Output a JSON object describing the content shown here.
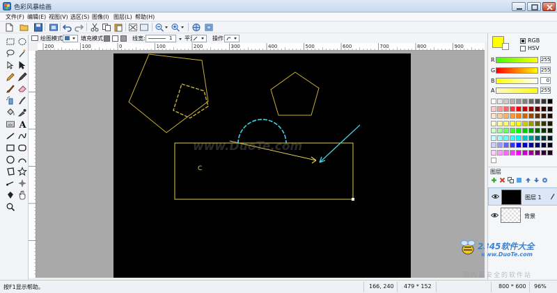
{
  "window": {
    "title": "色彩风暴绘画"
  },
  "menu": [
    "文件(F)",
    "编辑(E)",
    "视图(V)",
    "选区(S)",
    "图像(I)",
    "图层(L)",
    "帮助(H)"
  ],
  "options": {
    "draw_mode_label": "绘图模式:",
    "fill_mode_label": "填充模式:",
    "line_width_label": "线宽:",
    "line_width_value": "1",
    "smooth_label": "平滑:",
    "operation_label": "操作:"
  },
  "ruler_h_ticks": [
    "200",
    "100",
    "0",
    "100",
    "200",
    "300",
    "400",
    "500",
    "600",
    "700",
    "800",
    "900"
  ],
  "ruler_v_ticks": [
    "100",
    "200",
    "300",
    "400",
    "500"
  ],
  "color": {
    "primary": "#ffff00",
    "mode_rgb": "RGB",
    "mode_hsv": "HSV",
    "channels": [
      {
        "label": "R",
        "value": "255"
      },
      {
        "label": "G",
        "value": "255"
      },
      {
        "label": "B",
        "value": "0"
      },
      {
        "label": "A",
        "value": "255"
      }
    ],
    "palette": [
      "#ffffff",
      "#e6e6e6",
      "#cccccc",
      "#b3b3b3",
      "#999999",
      "#808080",
      "#666666",
      "#4d4d4d",
      "#333333",
      "#000000",
      "#ffcccc",
      "#ff9999",
      "#ff6666",
      "#ff3333",
      "#ff0000",
      "#cc0000",
      "#990000",
      "#660000",
      "#330000",
      "#1a0000",
      "#ffe5cc",
      "#ffcc99",
      "#ffb266",
      "#ff9933",
      "#ff8000",
      "#cc6600",
      "#994c00",
      "#663300",
      "#331a00",
      "#1a0d00",
      "#ffffcc",
      "#ffff99",
      "#ffff66",
      "#ffff33",
      "#ffff00",
      "#cccc00",
      "#999900",
      "#666600",
      "#333300",
      "#1a1a00",
      "#ccffcc",
      "#99ff99",
      "#66ff66",
      "#33ff33",
      "#00ff00",
      "#00cc00",
      "#009900",
      "#006600",
      "#003300",
      "#001a00",
      "#ccffff",
      "#99ffff",
      "#66ffff",
      "#33ffff",
      "#00ffff",
      "#00cccc",
      "#009999",
      "#006666",
      "#003333",
      "#001a1a",
      "#ccccff",
      "#9999ff",
      "#6666ff",
      "#3333ff",
      "#0000ff",
      "#0000cc",
      "#000099",
      "#000066",
      "#000033",
      "#00001a",
      "#ffccff",
      "#ff99ff",
      "#ff66ff",
      "#ff33ff",
      "#ff00ff",
      "#cc00cc",
      "#990099",
      "#660066",
      "#330033",
      "#1a001a"
    ]
  },
  "layers": {
    "panel_title": "图层",
    "items": [
      {
        "name": "图层 1"
      },
      {
        "name": "背景"
      }
    ]
  },
  "status": {
    "hint": "按F1显示帮助。",
    "cursor": "166, 240",
    "selection": "479 * 152",
    "image_size": "800 * 600",
    "zoom": "96%"
  },
  "canvas": {
    "letter": "C"
  },
  "watermarks": {
    "center": "www.DuoTe.com",
    "logo": "2345软件大全",
    "url": "www.DuoTe.com",
    "bottom": "国内最安全的软件站"
  }
}
